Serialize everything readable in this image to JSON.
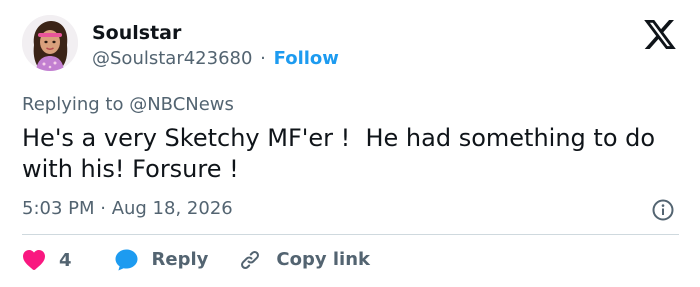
{
  "author": {
    "display_name": "Soulstar",
    "handle": "@Soulstar423680",
    "separator": "·",
    "follow_label": "Follow"
  },
  "reply_context": {
    "prefix": "Replying to ",
    "mention": "@NBCNews"
  },
  "tweet": {
    "text": "He's a very Sketchy MF'er !  He had something to do with his! Forsure !",
    "timestamp": "5:03 PM · Aug 18, 2026"
  },
  "actions": {
    "like_count": "4",
    "reply_label": "Reply",
    "copy_link_label": "Copy link"
  },
  "colors": {
    "like": "#f91880",
    "reply": "#1d9bf0",
    "link": "#1d9bf0",
    "secondary_text": "#536471",
    "primary_text": "#0f1419",
    "divider": "#cfd9de"
  },
  "icons": {
    "brand": "x-logo-icon",
    "info": "info-icon",
    "like": "heart-icon",
    "reply": "speech-bubble-icon",
    "copy_link": "link-icon"
  }
}
